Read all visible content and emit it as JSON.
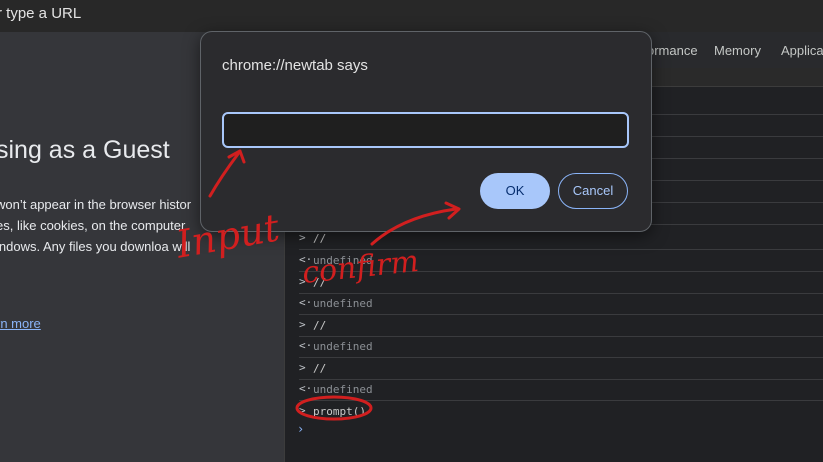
{
  "address_bar": {
    "text": "r type a URL"
  },
  "guest_page": {
    "title": "sing as a Guest",
    "description_lines": [
      "won’t appear in the browser histor",
      "es, like cookies, on the computer",
      "indows. Any files you downloa  will"
    ],
    "learn_more": "rn more"
  },
  "devtools": {
    "tabs": [
      "ormance",
      "Memory",
      "Applicat"
    ],
    "console_rows": [
      {
        "marker": ">",
        "text": "//",
        "kind": "input"
      },
      {
        "marker": "<·",
        "text": "undefined",
        "kind": "result"
      },
      {
        "marker": ">",
        "text": "//",
        "kind": "input"
      },
      {
        "marker": "<·",
        "text": "undefined",
        "kind": "result"
      },
      {
        "marker": ">",
        "text": "//",
        "kind": "input"
      },
      {
        "marker": "<·",
        "text": "undefined",
        "kind": "result"
      },
      {
        "marker": ">",
        "text": "//",
        "kind": "input"
      },
      {
        "marker": "<·",
        "text": "undefined",
        "kind": "result"
      },
      {
        "marker": ">",
        "text": "prompt()",
        "kind": "input"
      }
    ],
    "prompt_caret": "›"
  },
  "dialog": {
    "title": "chrome://newtab says",
    "input_value": "",
    "ok_label": "OK",
    "cancel_label": "Cancel"
  },
  "annotations": {
    "input_label": "Input",
    "confirm_label": "confirm",
    "color": "#d11f1f"
  }
}
